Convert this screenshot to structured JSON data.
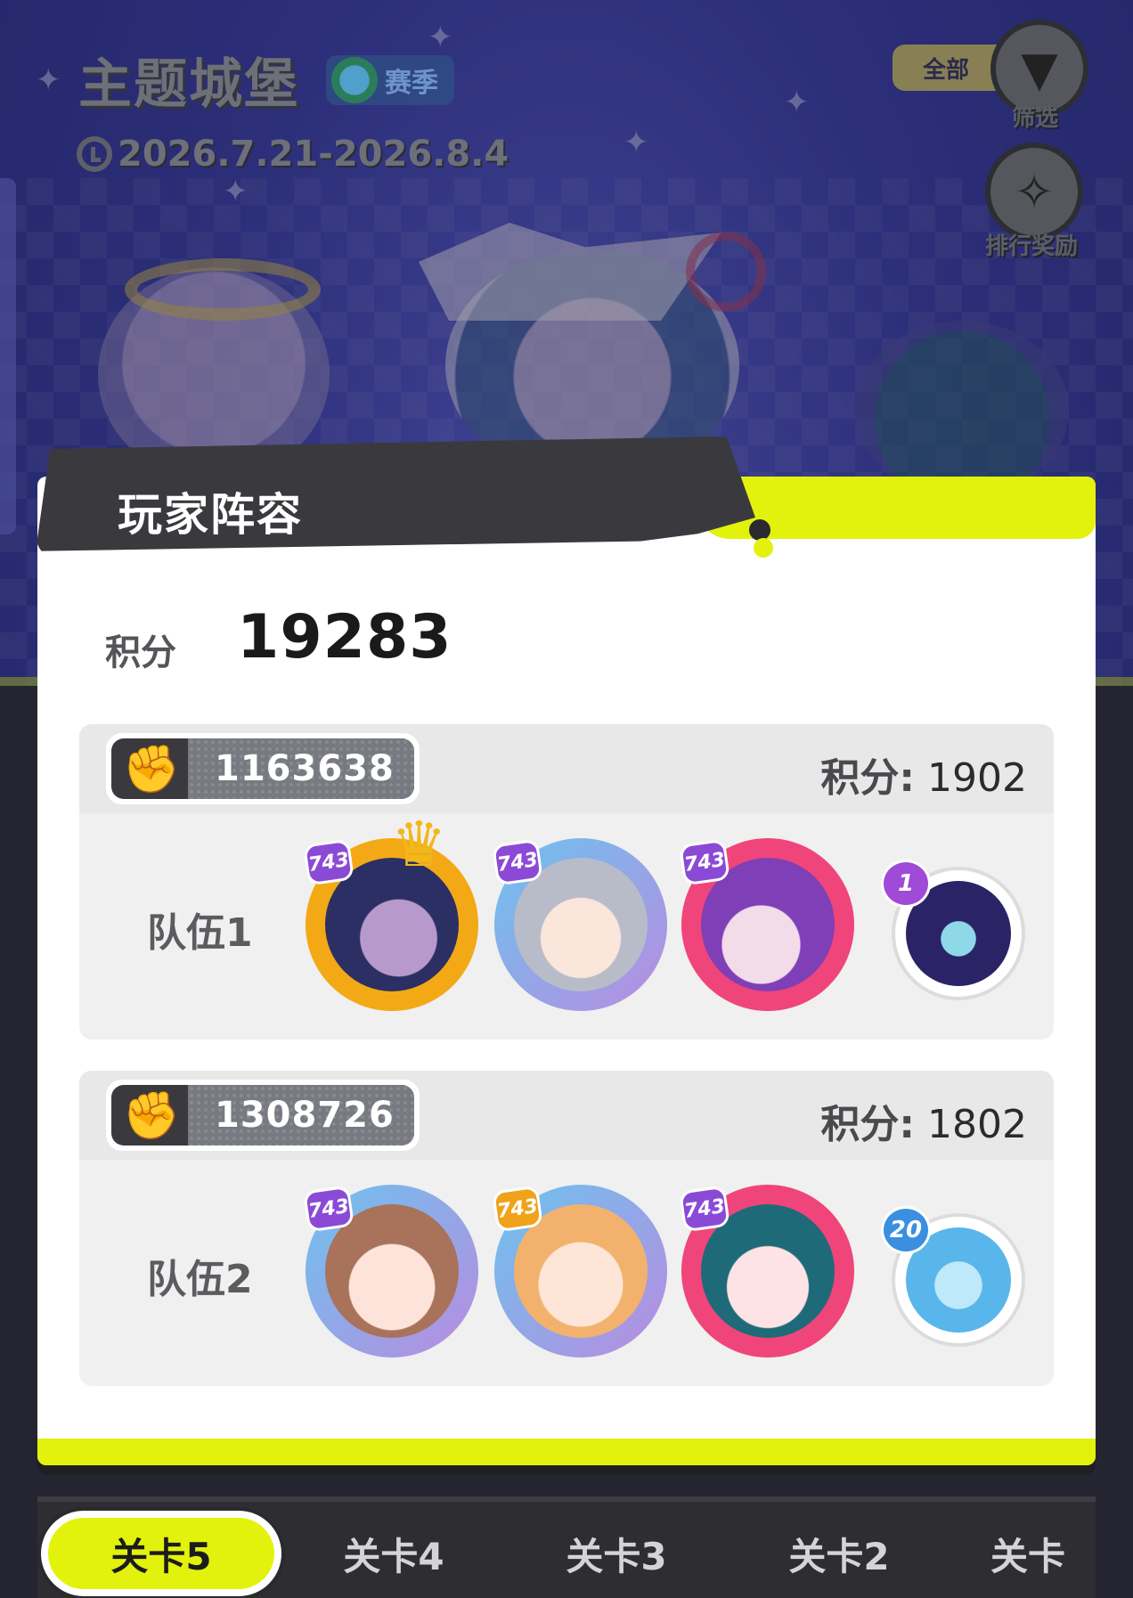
{
  "header": {
    "title": "主题城堡",
    "season_label": "赛季",
    "date_range": "2026.7.21-2026.8.4",
    "filter_value": "全部",
    "filter_label": "筛选",
    "rank_reward_label": "排行奖励"
  },
  "modal": {
    "title": "玩家阵容",
    "score_label": "积分",
    "score_value": "19283",
    "teams": [
      {
        "power": "1163638",
        "points_label": "积分:",
        "points_value": "1902",
        "name": "队伍1",
        "members": [
          {
            "level": "743",
            "frame": "gold",
            "crowned": true
          },
          {
            "level": "743",
            "frame": "purple-blue"
          },
          {
            "level": "743",
            "frame": "pink"
          }
        ],
        "pet": {
          "level": "1",
          "badge_color": "#a04ad8"
        }
      },
      {
        "power": "1308726",
        "points_label": "积分:",
        "points_value": "1802",
        "name": "队伍2",
        "members": [
          {
            "level": "743",
            "frame": "purple-blue"
          },
          {
            "level": "743",
            "frame": "purple-blue"
          },
          {
            "level": "743",
            "frame": "pink"
          }
        ],
        "pet": {
          "level": "20",
          "badge_color": "#3a8fe0"
        }
      }
    ]
  },
  "tabs": [
    {
      "label": "关卡5",
      "active": true
    },
    {
      "label": "关卡4",
      "active": false
    },
    {
      "label": "关卡3",
      "active": false
    },
    {
      "label": "关卡2",
      "active": false
    },
    {
      "label": "关卡",
      "active": false
    }
  ],
  "colors": {
    "accent_lime": "#e2f20c",
    "header_dark": "#3a3a3e",
    "crown_gold": "#f1b81a"
  }
}
